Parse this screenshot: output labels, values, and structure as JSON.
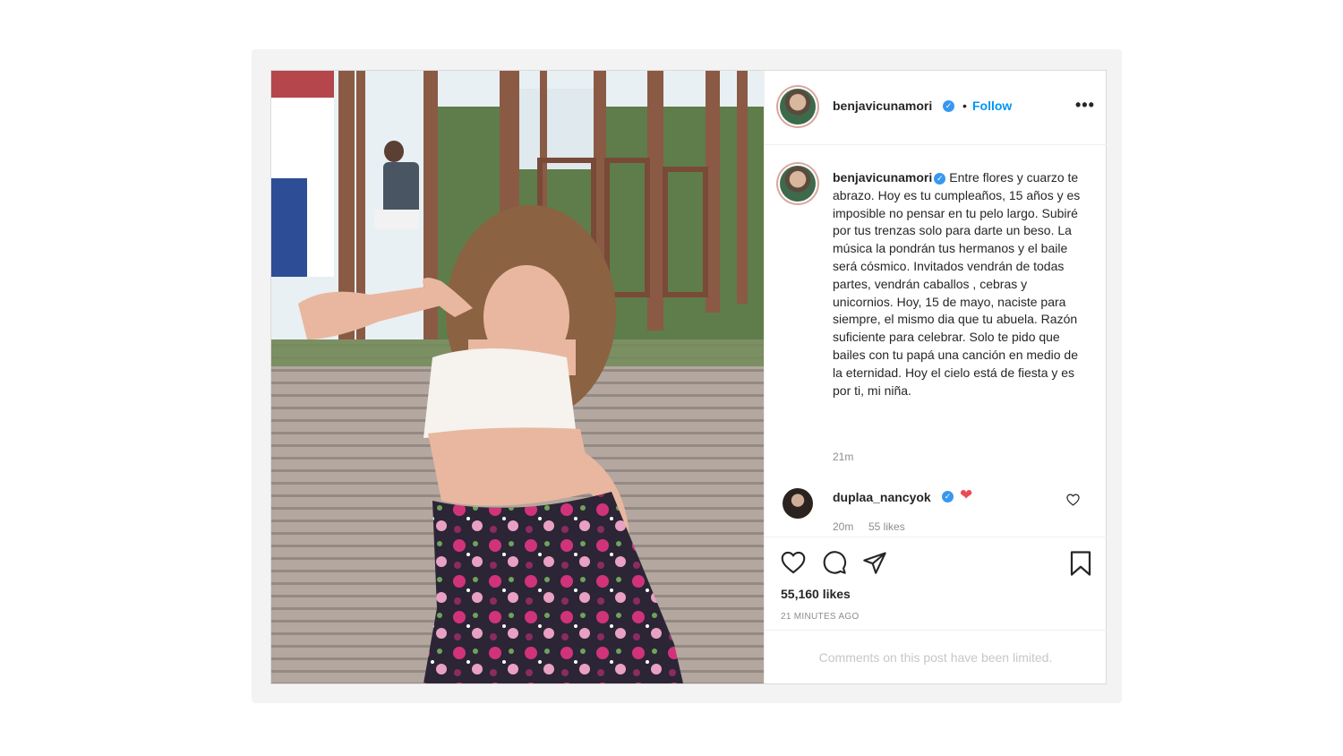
{
  "post": {
    "author": "benjavicunamori",
    "follow_label": "Follow",
    "dot": "•",
    "more_label": "•••",
    "verified_mark": "✓",
    "caption": "Entre flores y cuarzo te abrazo. Hoy es tu cumpleaños, 15 años y es imposible no pensar en tu pelo largo. Subiré por tus trenzas solo para darte un beso. La música la pondrán tus hermanos y el baile será cósmico. Invitados vendrán de todas partes, vendrán caballos , cebras y unicornios. Hoy, 15 de mayo, naciste para siempre, el mismo dia que tu abuela. Razón suficiente para celebrar. Solo te pido que bailes con tu papá una canción en medio de la eternidad. Hoy el cielo está de fiesta y es por ti, mi niña.",
    "caption_time": "21m",
    "comment": {
      "user": "duplaa_nancyok",
      "text": "❤",
      "time": "20m",
      "likes": "55 likes"
    },
    "likes": "55,160 likes",
    "posted_ago": "21 MINUTES AGO",
    "comments_limited": "Comments on this post have been limited."
  },
  "icons": {
    "like": "heart-icon",
    "comment": "comment-icon",
    "share": "paper-plane-icon",
    "save": "bookmark-icon",
    "comment_like": "small-heart-icon",
    "more": "more-options-icon"
  },
  "colors": {
    "link_blue": "#0095f6",
    "verified_blue": "#3897f0",
    "heart_red": "#ed4956",
    "muted": "#8e8e8e"
  }
}
